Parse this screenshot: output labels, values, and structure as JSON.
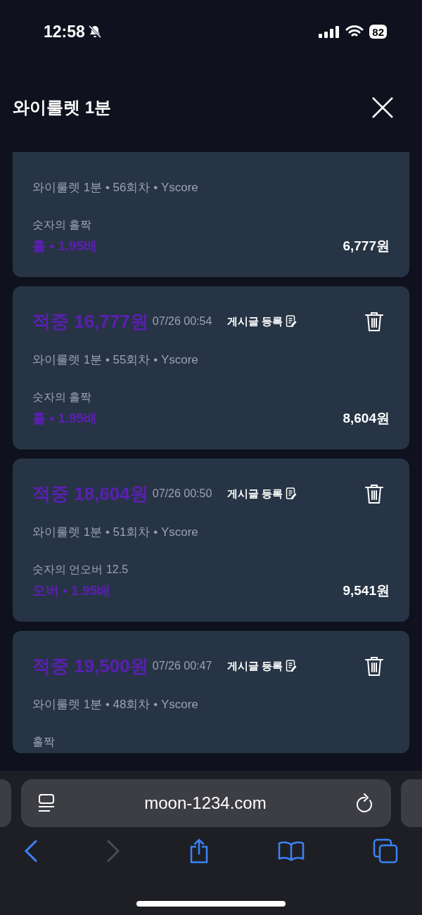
{
  "status_bar": {
    "time": "12:58",
    "silent": true,
    "battery": "82"
  },
  "header": {
    "title": "와이룰렛 1분"
  },
  "bets": [
    {
      "kind": "partial",
      "meta": "와이룰렛 1분 • 56회차 • Yscore",
      "market": "숫자의 홀짝",
      "pick": "홀 • 1.95배",
      "stake": "6,777원"
    },
    {
      "kind": "full",
      "win": "적중 16,777원",
      "time": "07/26 00:54",
      "post": "게시글 등록",
      "meta": "와이룰렛 1분 • 55회차 • Yscore",
      "market": "숫자의 홀짝",
      "pick": "홀 • 1.95배",
      "stake": "8,604원"
    },
    {
      "kind": "full",
      "win": "적중 18,604원",
      "time": "07/26 00:50",
      "post": "게시글 등록",
      "meta": "와이룰렛 1분 • 51회차 • Yscore",
      "market": "숫자의 언오버 12.5",
      "pick": "오버 • 1.95배",
      "stake": "9,541원"
    },
    {
      "kind": "cut",
      "win": "적중 19,500원",
      "time": "07/26 00:47",
      "post": "게시글 등록",
      "meta": "와이룰렛 1분 • 48회차 • Yscore",
      "market": "홀짝"
    }
  ],
  "browser": {
    "url": "moon-1234.com",
    "forward_disabled": true
  }
}
